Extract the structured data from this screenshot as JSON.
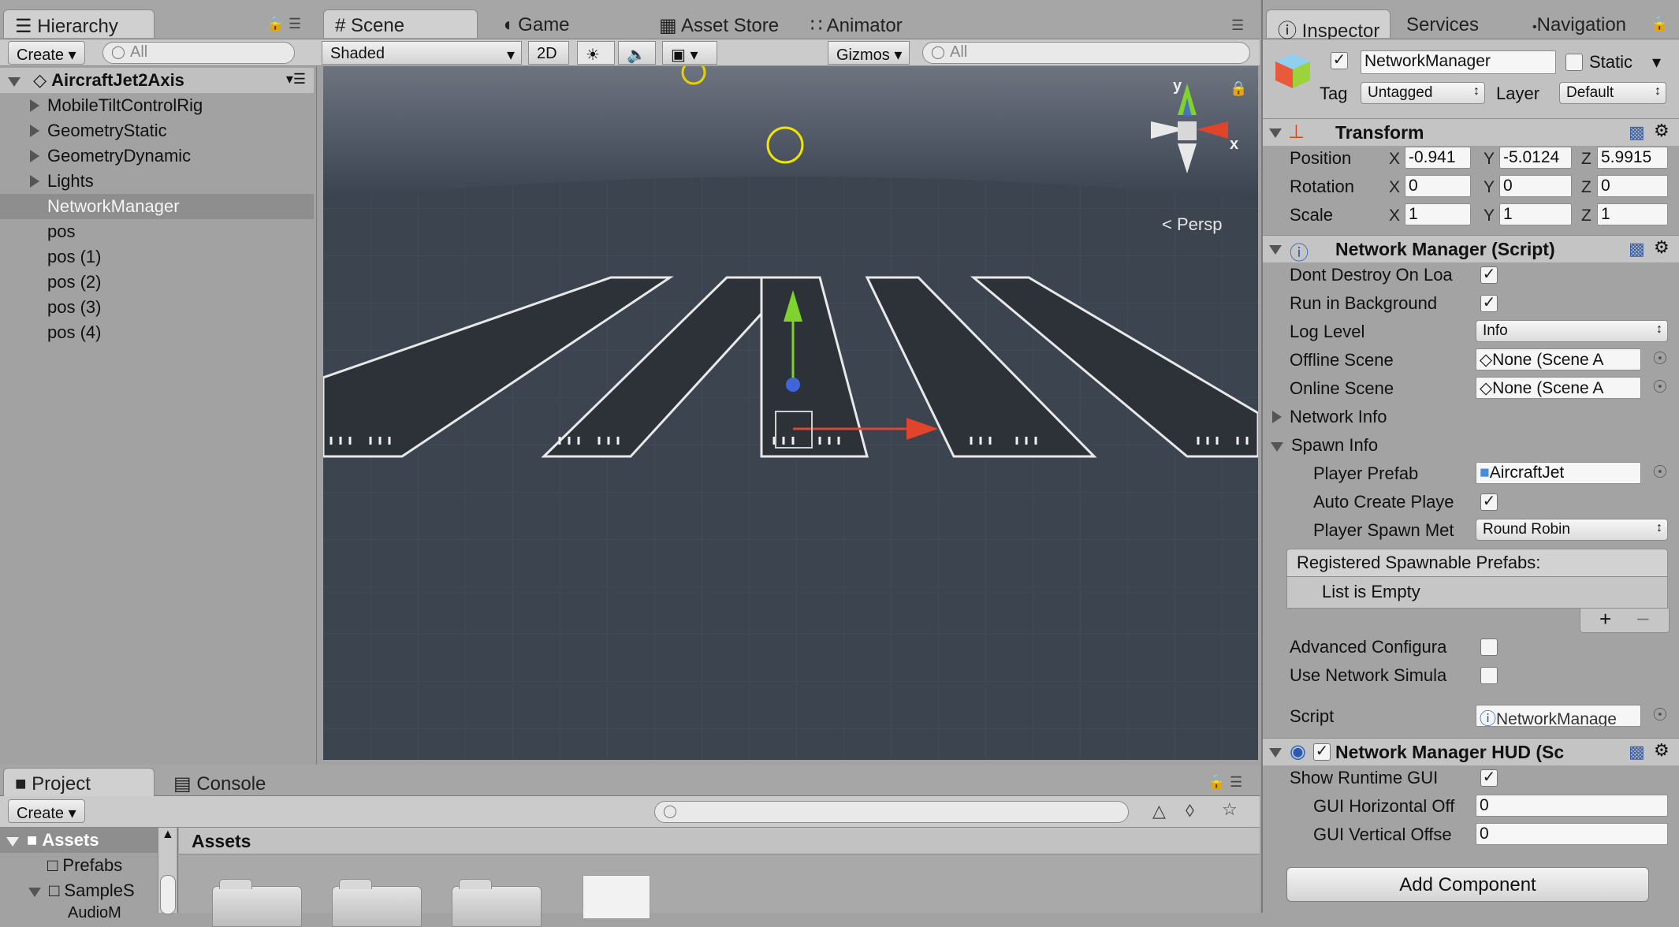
{
  "hierarchy": {
    "tab": "Hierarchy",
    "create": "Create",
    "search_placeholder": "All",
    "scene_name": "AircraftJet2Axis",
    "items": [
      {
        "label": "MobileTiltControlRig",
        "expandable": true
      },
      {
        "label": "GeometryStatic",
        "expandable": true
      },
      {
        "label": "GeometryDynamic",
        "expandable": true
      },
      {
        "label": "Lights",
        "expandable": true
      },
      {
        "label": "NetworkManager",
        "selected": true
      },
      {
        "label": "pos"
      },
      {
        "label": "pos (1)"
      },
      {
        "label": "pos (2)"
      },
      {
        "label": "pos (3)"
      },
      {
        "label": "pos (4)"
      }
    ]
  },
  "scene": {
    "tabs": [
      "Scene",
      "Game",
      "Asset Store",
      "Animator"
    ],
    "shading": "Shaded",
    "mode_2d": "2D",
    "gizmos": "Gizmos",
    "search_placeholder": "All",
    "projection": "Persp",
    "gizmo_y": "y",
    "gizmo_x": "x"
  },
  "project": {
    "tabs": [
      "Project",
      "Console"
    ],
    "create": "Create",
    "tree": [
      {
        "label": "Assets",
        "selected": true
      },
      {
        "label": "Prefabs"
      },
      {
        "label": "SampleS"
      },
      {
        "label": "AudioM"
      }
    ],
    "breadcrumb": "Assets"
  },
  "inspector": {
    "tabs": [
      "Inspector",
      "Services",
      "Navigation"
    ],
    "object_name": "NetworkManager",
    "static_label": "Static",
    "tag_label": "Tag",
    "tag_value": "Untagged",
    "layer_label": "Layer",
    "layer_value": "Default",
    "transform": {
      "title": "Transform",
      "rows": [
        {
          "label": "Position",
          "x": "-0.941",
          "y": "-5.0124",
          "z": "5.9915"
        },
        {
          "label": "Rotation",
          "x": "0",
          "y": "0",
          "z": "0"
        },
        {
          "label": "Scale",
          "x": "1",
          "y": "1",
          "z": "1"
        }
      ]
    },
    "network_manager": {
      "title": "Network Manager (Script)",
      "dont_destroy": "Dont Destroy On Loa",
      "run_background": "Run in Background",
      "log_level_label": "Log Level",
      "log_level_value": "Info",
      "offline_scene_label": "Offline Scene",
      "offline_scene_value": "None (Scene A",
      "online_scene_label": "Online Scene",
      "online_scene_value": "None (Scene A",
      "network_info": "Network Info",
      "spawn_info": "Spawn Info",
      "player_prefab_label": "Player Prefab",
      "player_prefab_value": "AircraftJet",
      "auto_create_label": "Auto Create Playe",
      "spawn_method_label": "Player Spawn Met",
      "spawn_method_value": "Round Robin",
      "registered_title": "Registered Spawnable Prefabs:",
      "list_empty": "List is Empty",
      "advanced_label": "Advanced Configura",
      "simulator_label": "Use Network Simula",
      "script_label": "Script",
      "script_value": "NetworkManage"
    },
    "hud": {
      "title": "Network Manager HUD (Sc",
      "show_gui": "Show Runtime GUI",
      "h_offset_label": "GUI Horizontal Off",
      "h_offset_value": "0",
      "v_offset_label": "GUI Vertical Offse",
      "v_offset_value": "0"
    },
    "add_component": "Add Component"
  },
  "colors": {
    "panel_bg": "#a2a2a2",
    "selected_row": "#8e8e8e",
    "scene_sky": "#5c6470",
    "scene_ground": "#3c4450",
    "gizmo_green": "#7fd32c",
    "gizmo_red": "#e0442a",
    "gizmo_blue": "#3e66d6"
  }
}
